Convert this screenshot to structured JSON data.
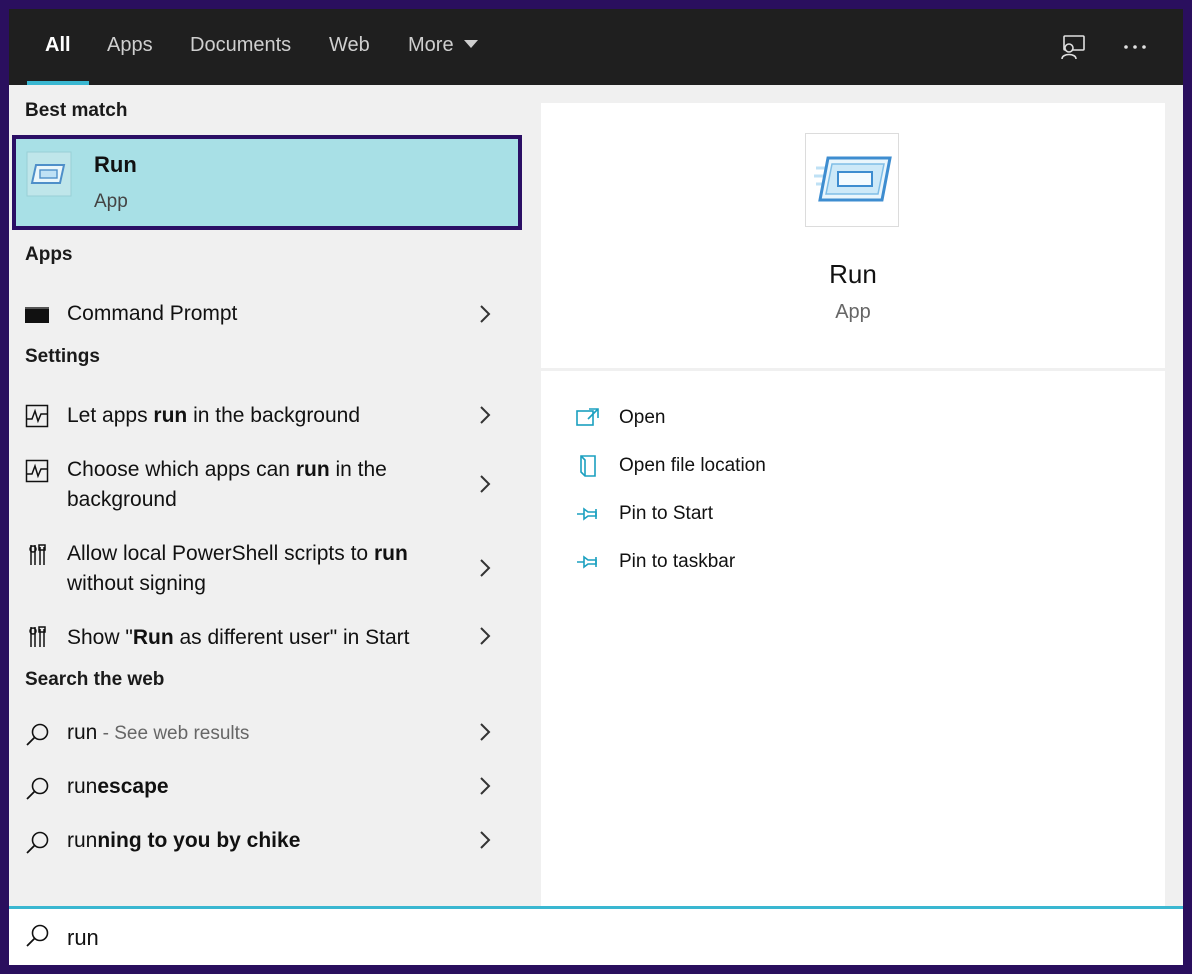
{
  "tabs": [
    {
      "label": "All",
      "active": true
    },
    {
      "label": "Apps"
    },
    {
      "label": "Documents"
    },
    {
      "label": "Web"
    },
    {
      "label": "More"
    }
  ],
  "topbar_icons": [
    "feedback-icon",
    "more-options-icon"
  ],
  "sections": {
    "best_match": "Best match",
    "apps": "Apps",
    "settings": "Settings",
    "search_web": "Search the web"
  },
  "best_match": {
    "name": "Run",
    "type": "App",
    "icon": "run-app-icon"
  },
  "apps": [
    {
      "label": "Command Prompt",
      "icon": "command-prompt-icon"
    }
  ],
  "settings": [
    {
      "pre": "Let apps ",
      "bold": "run",
      "post": " in the background",
      "icon": "activity-monitor-icon"
    },
    {
      "pre": "Choose which apps can ",
      "bold": "run",
      "post": " in the background",
      "icon": "activity-monitor-icon"
    },
    {
      "pre": "Allow local PowerShell scripts to ",
      "bold": "run",
      "post": " without signing",
      "icon": "developer-tools-icon"
    },
    {
      "pre": "Show \"",
      "bold": "Run",
      "post": " as different user\" in Start",
      "icon": "developer-tools-icon"
    }
  ],
  "web": [
    {
      "pre": "run",
      "bold": "",
      "dim": " - See web results"
    },
    {
      "pre": "run",
      "bold": "escape",
      "dim": ""
    },
    {
      "pre": "run",
      "bold": "ning to you by chike",
      "dim": ""
    }
  ],
  "preview": {
    "name": "Run",
    "type": "App",
    "actions": [
      {
        "label": "Open",
        "icon": "open-icon"
      },
      {
        "label": "Open file location",
        "icon": "file-location-icon"
      },
      {
        "label": "Pin to Start",
        "icon": "pin-icon"
      },
      {
        "label": "Pin to taskbar",
        "icon": "pin-icon"
      }
    ]
  },
  "search": {
    "value": "run"
  },
  "colors": {
    "accent": "#3ab7d1",
    "selected_bg": "#a8e0e6",
    "selected_border": "#2b0f65",
    "outer_frame": "#2a0f5e"
  }
}
